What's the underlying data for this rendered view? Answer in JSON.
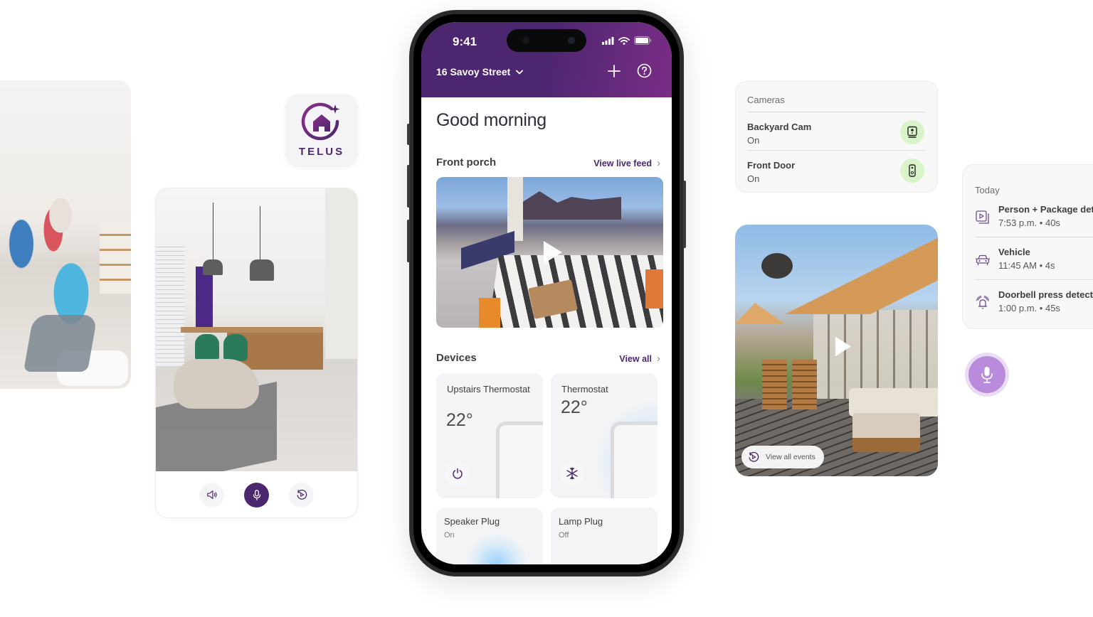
{
  "phone": {
    "status_bar": {
      "time": "9:41"
    },
    "header": {
      "address": "16 Savoy Street",
      "add_icon": "plus-icon",
      "help_icon": "question-circle-icon",
      "gradient_start": "#4d2670",
      "gradient_end": "#7a2d86"
    },
    "greeting": "Good morning",
    "front_porch": {
      "title": "Front porch",
      "link_label": "View live feed"
    },
    "devices": {
      "title": "Devices",
      "link_label": "View all",
      "items": [
        {
          "name": "Upstairs Thermostat",
          "value": "22°",
          "icon": "power-icon"
        },
        {
          "name": "Thermostat",
          "value": "22°",
          "icon": "snowflake-icon"
        },
        {
          "name": "Speaker Plug",
          "state": "On"
        },
        {
          "name": "Lamp Plug",
          "state": "Off"
        }
      ]
    }
  },
  "app_icon": {
    "wordmark": "TELUS",
    "brand_color": "#4b286d"
  },
  "living_room_controls": {
    "buttons": [
      {
        "name": "speaker",
        "icon": "speaker-icon"
      },
      {
        "name": "microphone",
        "icon": "microphone-icon"
      },
      {
        "name": "replay",
        "icon": "replay-icon"
      }
    ]
  },
  "cameras": {
    "title": "Cameras",
    "items": [
      {
        "name": "Backyard Cam",
        "state": "On",
        "icon": "indoor-camera-icon"
      },
      {
        "name": "Front Door",
        "state": "On",
        "icon": "doorbell-camera-icon"
      }
    ],
    "status_color": "#d9f4c8"
  },
  "events": {
    "title": "Today",
    "items": [
      {
        "title": "Person + Package detected",
        "meta": "7:53 p.m. • 40s",
        "icon": "video-clip-icon"
      },
      {
        "title": "Vehicle",
        "meta": "11:45 AM • 4s",
        "icon": "car-icon"
      },
      {
        "title": "Doorbell press detected",
        "meta": "1:00 p.m. • 45s",
        "icon": "doorbell-ring-icon"
      }
    ]
  },
  "patio": {
    "view_all_label": "View all events"
  },
  "accent": "#4b286d",
  "mic_fab_color": "#b98bdc"
}
